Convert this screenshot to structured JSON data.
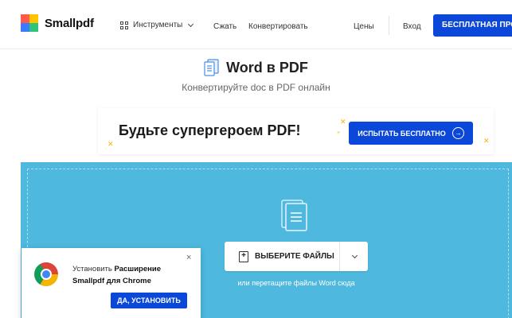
{
  "header": {
    "logo_text": "Smallpdf",
    "tools_label": "Инструменты",
    "compress_label": "Сжать",
    "convert_label": "Конвертировать",
    "pricing_label": "Цены",
    "login_label": "Вход",
    "free_trial_label": "БЕСПЛАТНАЯ ПРОБ"
  },
  "main": {
    "title": "Word в PDF",
    "subtitle": "Конвертируйте doc в PDF онлайн"
  },
  "promo": {
    "headline": "Будьте супергероем PDF!",
    "button_label": "ИСПЫТАТЬ БЕСПЛАТНО"
  },
  "dropzone": {
    "choose_label": "ВЫБЕРИТЕ ФАЙЛЫ",
    "hint": "или перетащите файлы Word сюда"
  },
  "chrome_popup": {
    "line1_prefix": "Установить",
    "line1_bold": "Расширение",
    "line2": "Smallpdf для Chrome",
    "button_label": "ДА, УСТАНОВИТЬ",
    "close": "×"
  },
  "colors": {
    "brand_blue": "#0b48d9",
    "dropzone_blue": "#4fb8df",
    "logo_red": "#ff5a4a",
    "logo_yellow": "#ffc400",
    "logo_blue": "#3a7bff",
    "logo_green": "#2fc47a"
  },
  "icons": {
    "logo": "smallpdf-logo-icon",
    "tools": "grid-icon",
    "doc": "word-doc-icon",
    "files": "files-icon",
    "arrow": "arrow-right-circle-icon",
    "chrome": "chrome-icon"
  }
}
